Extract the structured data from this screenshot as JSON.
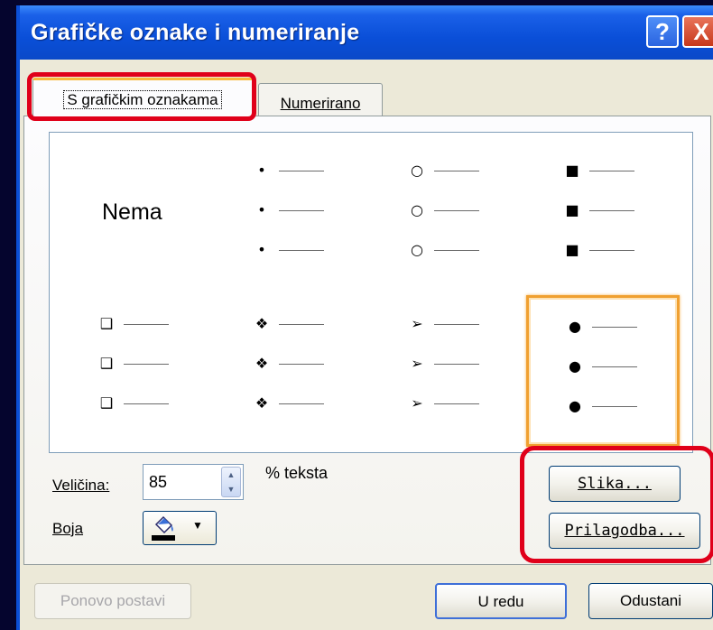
{
  "window": {
    "title": "Grafičke oznake i numeriranje",
    "help_label": "?",
    "close_label": "X"
  },
  "tabs": [
    {
      "label": "S grafičkim oznakama",
      "selected": true
    },
    {
      "label": "Numerirano",
      "selected": false
    }
  ],
  "gallery": {
    "none_label": "Nema",
    "selected_index": 7,
    "styles": [
      {
        "icon": "none"
      },
      {
        "icon": "small-filled-dot-icon",
        "glyph": "•"
      },
      {
        "icon": "hollow-circle-icon",
        "glyph": "○"
      },
      {
        "icon": "filled-square-icon",
        "glyph": "■"
      },
      {
        "icon": "hollow-square-icon",
        "glyph": "❑"
      },
      {
        "icon": "four-diamond-icon",
        "glyph": "❖"
      },
      {
        "icon": "arrowhead-icon",
        "glyph": "➢"
      },
      {
        "icon": "large-filled-dot-icon",
        "glyph": "●"
      }
    ]
  },
  "size": {
    "label": "Veličina:",
    "value": "85",
    "unit_label": "% teksta"
  },
  "color": {
    "label": "Boja",
    "current_color": "#000000"
  },
  "buttons": {
    "picture": "Slika...",
    "customize": "Prilagodba...",
    "reset": "Ponovo postavi",
    "ok": "U redu",
    "cancel": "Odustani"
  },
  "colors": {
    "titlebar": "#0a4fd8",
    "highlight": "#e0001a",
    "selection": "#f0a030",
    "dialog_bg": "#ece9d8"
  }
}
